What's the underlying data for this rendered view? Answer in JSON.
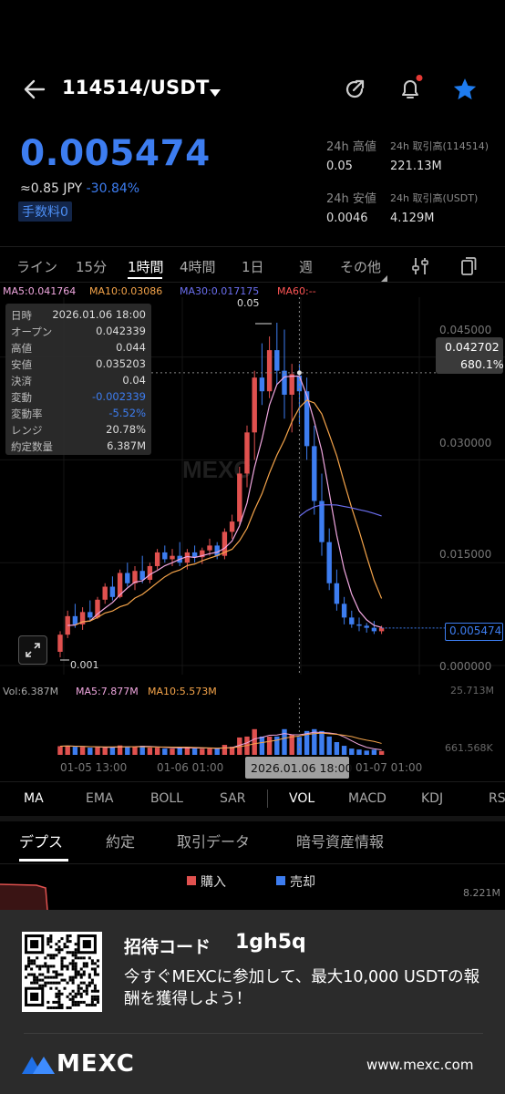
{
  "header": {
    "pair": "114514/USDT"
  },
  "ticker": {
    "price": "0.005474",
    "fiat": "≈0.85 JPY",
    "change": "-30.84%",
    "fee_label": "手数料0"
  },
  "stats": {
    "high_label": "24h 高値",
    "high_value": "0.05",
    "vol_label": "24h 取引高(114514)",
    "vol_value": "221.13M",
    "low_label": "24h 安値",
    "low_value": "0.0046",
    "turnover_label": "24h 取引高(USDT)",
    "turnover_value": "4.129M"
  },
  "interval_tabs": [
    "ライン",
    "15分",
    "1時間",
    "4時間",
    "1日",
    "週",
    "その他"
  ],
  "active_interval": "1時間",
  "ma_legend": {
    "ma5": "MA5:0.041764",
    "ma10": "MA10:0.03086",
    "ma30": "MA30:0.017175",
    "ma60": "MA60:--"
  },
  "tooltip": [
    {
      "k": "日時",
      "v": "2026.01.06 18:00"
    },
    {
      "k": "オープン",
      "v": "0.042339"
    },
    {
      "k": "高値",
      "v": "0.044"
    },
    {
      "k": "安値",
      "v": "0.035203"
    },
    {
      "k": "決済",
      "v": "0.04"
    },
    {
      "k": "変動",
      "v": "-0.002339"
    },
    {
      "k": "変動率",
      "v": "-5.52%"
    },
    {
      "k": "レンジ",
      "v": "20.78%"
    },
    {
      "k": "約定数量",
      "v": "6.387M"
    }
  ],
  "price_axis": {
    "ticks": [
      "0.045000",
      "0.030000",
      "0.015000",
      "0.000000"
    ],
    "crosshair_price": "0.042702",
    "crosshair_pct": "680.1%",
    "last_price": "0.005474",
    "max_label": "0.05",
    "min_label": "0.001"
  },
  "volume": {
    "vol": "Vol:6.387M",
    "ma5": "MA5:7.877M",
    "ma10": "MA10:5.573M",
    "max": "25.713M",
    "min": "661.568K"
  },
  "time_axis": {
    "labels": [
      "01-05 13:00",
      "01-06 01:00",
      "01-07 01:00"
    ],
    "crosshair_time": "2026.01.06 18:00"
  },
  "indicators": [
    "MA",
    "EMA",
    "BOLL",
    "SAR",
    "VOL",
    "MACD",
    "KDJ",
    "RS"
  ],
  "bottom_tabs": [
    "デプス",
    "約定",
    "取引データ",
    "暗号資産情報"
  ],
  "depth_legend": {
    "buy": "購入",
    "sell": "売却",
    "max": "8.221M"
  },
  "banner": {
    "title": "招待コード",
    "code": "1gh5q",
    "text": "今すぐMEXCに参加して、最大10,000 USDTの報酬を獲得しよう！",
    "brand": "MEXC",
    "url": "www.mexc.com"
  },
  "watermark": "MEXC",
  "colors": {
    "up": "#e0514f",
    "down": "#3d7df0",
    "ma5": "#f1a7e0",
    "ma10": "#f5a44a",
    "ma30": "#6b6ff0",
    "ma60": "#ff5555"
  },
  "chart_data": {
    "type": "candlestick",
    "interval": "1時間",
    "y_range": [
      0,
      0.05
    ],
    "candles": [
      [
        0.002,
        0.005,
        0.0012,
        0.0045
      ],
      [
        0.0045,
        0.008,
        0.004,
        0.0072
      ],
      [
        0.0072,
        0.009,
        0.0055,
        0.006
      ],
      [
        0.006,
        0.0085,
        0.0052,
        0.0078
      ],
      [
        0.0078,
        0.0095,
        0.0065,
        0.007
      ],
      [
        0.007,
        0.01,
        0.0068,
        0.0096
      ],
      [
        0.0096,
        0.012,
        0.009,
        0.0115
      ],
      [
        0.0115,
        0.013,
        0.0095,
        0.01
      ],
      [
        0.01,
        0.014,
        0.0098,
        0.0135
      ],
      [
        0.0135,
        0.015,
        0.0115,
        0.012
      ],
      [
        0.012,
        0.0145,
        0.011,
        0.0138
      ],
      [
        0.0138,
        0.016,
        0.012,
        0.0125
      ],
      [
        0.0125,
        0.015,
        0.012,
        0.0145
      ],
      [
        0.0145,
        0.017,
        0.014,
        0.0165
      ],
      [
        0.0165,
        0.0175,
        0.015,
        0.0155
      ],
      [
        0.0155,
        0.017,
        0.0145,
        0.016
      ],
      [
        0.016,
        0.018,
        0.0145,
        0.015
      ],
      [
        0.015,
        0.017,
        0.014,
        0.0165
      ],
      [
        0.0165,
        0.0175,
        0.015,
        0.0158
      ],
      [
        0.0158,
        0.0172,
        0.0148,
        0.0168
      ],
      [
        0.0168,
        0.0185,
        0.016,
        0.0175
      ],
      [
        0.0175,
        0.018,
        0.0155,
        0.016
      ],
      [
        0.016,
        0.02,
        0.0155,
        0.0195
      ],
      [
        0.0195,
        0.022,
        0.0185,
        0.021
      ],
      [
        0.021,
        0.029,
        0.0205,
        0.028
      ],
      [
        0.028,
        0.035,
        0.026,
        0.034
      ],
      [
        0.034,
        0.043,
        0.03,
        0.042
      ],
      [
        0.042,
        0.047,
        0.038,
        0.04
      ],
      [
        0.04,
        0.048,
        0.039,
        0.046
      ],
      [
        0.046,
        0.05,
        0.041,
        0.043
      ],
      [
        0.043,
        0.049,
        0.036,
        0.0395
      ],
      [
        0.0395,
        0.044,
        0.034,
        0.0425
      ],
      [
        0.0423,
        0.044,
        0.0352,
        0.04
      ],
      [
        0.04,
        0.042,
        0.03,
        0.032
      ],
      [
        0.032,
        0.035,
        0.022,
        0.024
      ],
      [
        0.024,
        0.028,
        0.016,
        0.018
      ],
      [
        0.018,
        0.02,
        0.011,
        0.012
      ],
      [
        0.012,
        0.014,
        0.008,
        0.009
      ],
      [
        0.009,
        0.01,
        0.006,
        0.007
      ],
      [
        0.007,
        0.008,
        0.0055,
        0.006
      ],
      [
        0.006,
        0.007,
        0.005,
        0.0058
      ],
      [
        0.0058,
        0.0062,
        0.0048,
        0.0055
      ],
      [
        0.0055,
        0.0065,
        0.0046,
        0.005
      ],
      [
        0.005,
        0.0058,
        0.0046,
        0.0055
      ]
    ]
  }
}
